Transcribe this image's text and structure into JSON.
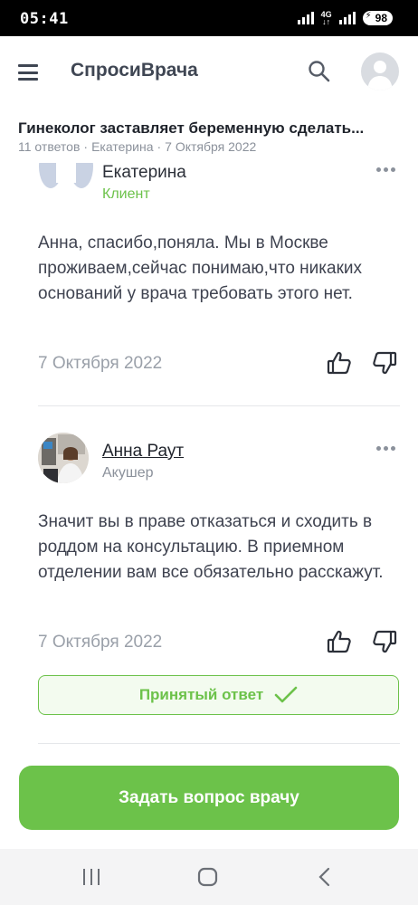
{
  "status_bar": {
    "time": "05:41",
    "network": "4G",
    "battery": "98"
  },
  "header": {
    "logo": "СпросиВрача",
    "search_icon": "search-icon",
    "avatar_icon": "user-avatar-icon"
  },
  "question": {
    "title": "Гинеколог заставляет беременную сделать...",
    "answers_count": "11 ответов",
    "author": "Екатерина",
    "date": "7 Октября 2022"
  },
  "answers": [
    {
      "author": "Екатерина",
      "role": "Клиент",
      "text": "Анна, спасибо,поняла. Мы в Москве проживаем,сейчас понимаю,что никаких оснований у врача требовать этого нет.",
      "date": "7 Октября 2022"
    },
    {
      "author": "Анна Раут",
      "role": "Акушер",
      "text": "Значит вы в праве отказаться и сходить в роддом на консультацию. В приемном отделении вам все обязательно расскажут.",
      "date": "7 Октября 2022",
      "accepted_label": "Принятый ответ"
    }
  ],
  "cta": {
    "label": "Задать вопрос врачу"
  },
  "colors": {
    "accent": "#6cc24a",
    "text": "#3f4350",
    "muted": "#9aa0a9"
  }
}
